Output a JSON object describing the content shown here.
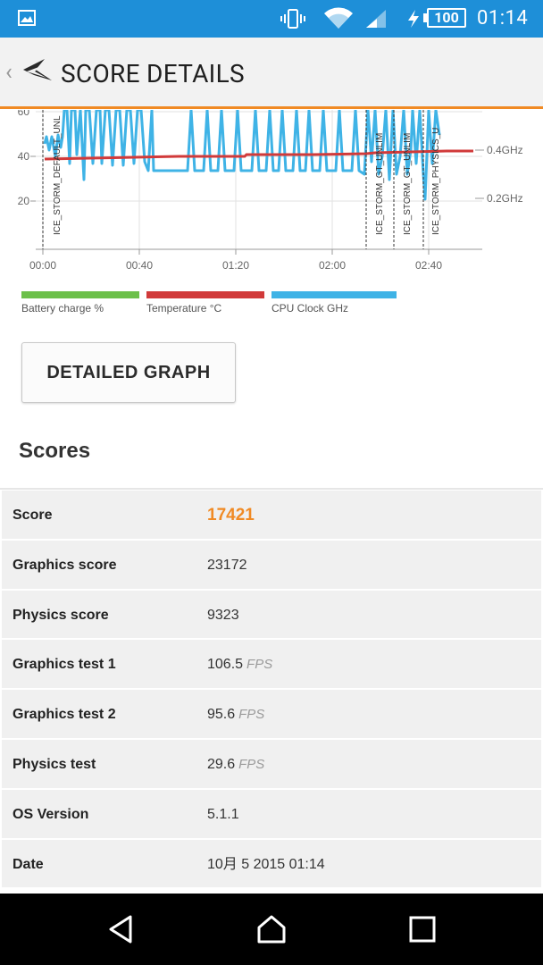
{
  "status_bar": {
    "battery_level": "100",
    "time": "01:14",
    "icons": [
      "gallery-icon",
      "vibrate-icon",
      "wifi-icon",
      "signal-icon",
      "charging-icon",
      "battery-icon"
    ]
  },
  "app_bar": {
    "title": "SCORE DETAILS",
    "back_icon": "chevron-left-icon",
    "logo_icon": "3dmark-logo-icon"
  },
  "chart_data": {
    "type": "line",
    "x_ticks": [
      "00:00",
      "00:40",
      "01:20",
      "02:00",
      "02:40"
    ],
    "y_ticks_left": [
      "20",
      "40",
      "60"
    ],
    "y_ticks_right": [
      "0.2GHz",
      "0.4GHz"
    ],
    "markers": [
      "ICE_STORM_DEFAULT_UNL",
      "ICE_STORM_GT_UNLIM",
      "ICE_STORM_GT_UNLIM",
      "ICE_STORM_PHYSICS_U"
    ],
    "series": [
      {
        "name": "Battery charge %",
        "color": "#6cc04a"
      },
      {
        "name": "Temperature °C",
        "color": "#d13a3a",
        "values": [
          39,
          39,
          40,
          40,
          40,
          40,
          41,
          41,
          42,
          42
        ]
      },
      {
        "name": "CPU Clock GHz",
        "color": "#3fb3e6"
      }
    ]
  },
  "legend": [
    {
      "label": "Battery charge %",
      "color": "#6cc04a"
    },
    {
      "label": "Temperature °C",
      "color": "#d13a3a"
    },
    {
      "label": "CPU Clock GHz",
      "color": "#3fb3e6"
    }
  ],
  "detail_button": {
    "label": "DETAILED GRAPH"
  },
  "scores": {
    "title": "Scores",
    "rows": [
      {
        "key": "Score",
        "value": "17421",
        "unit": ""
      },
      {
        "key": "Graphics score",
        "value": "23172",
        "unit": ""
      },
      {
        "key": "Physics score",
        "value": "9323",
        "unit": ""
      },
      {
        "key": "Graphics test 1",
        "value": "106.5",
        "unit": "FPS"
      },
      {
        "key": "Graphics test 2",
        "value": "95.6",
        "unit": "FPS"
      },
      {
        "key": "Physics test",
        "value": "29.6",
        "unit": "FPS"
      },
      {
        "key": "OS Version",
        "value": "5.1.1",
        "unit": ""
      },
      {
        "key": "Date",
        "value": "10月 5 2015 01:14",
        "unit": ""
      }
    ]
  },
  "colors": {
    "status_bar": "#1e8fd8",
    "accent": "#f08a24"
  },
  "nav_bar": {
    "icons": [
      "back-triangle-icon",
      "home-icon",
      "recents-icon"
    ]
  }
}
